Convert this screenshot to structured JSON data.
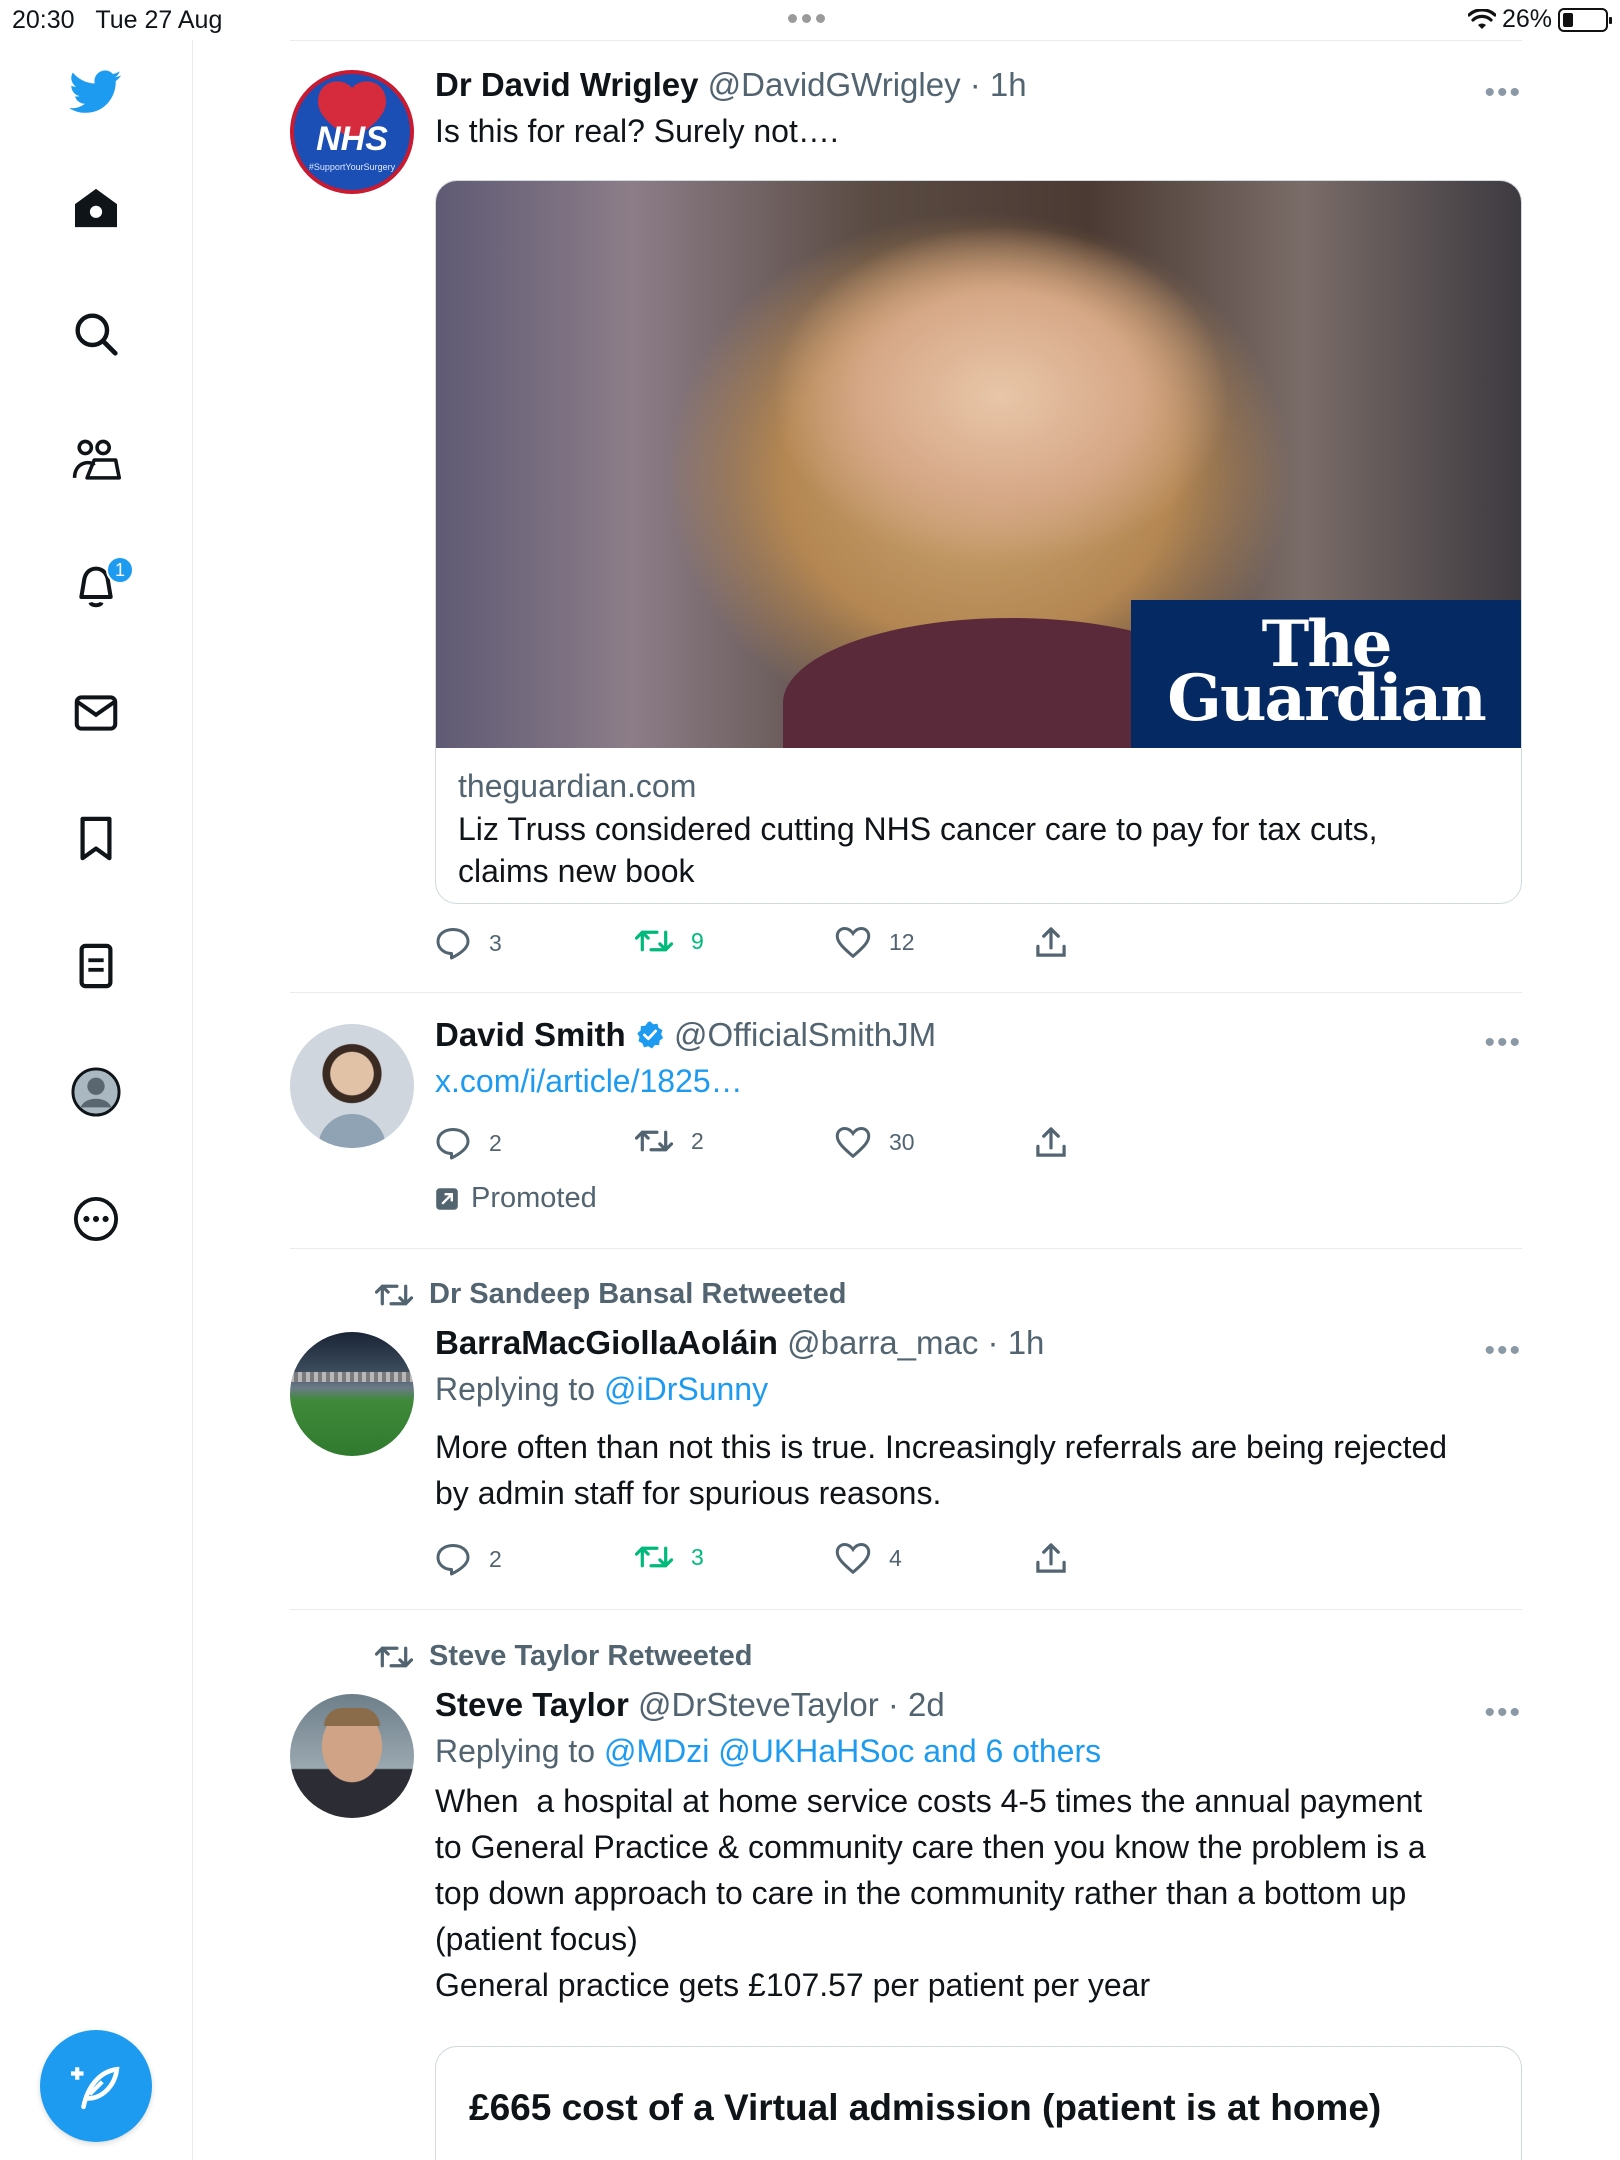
{
  "status_bar": {
    "time": "20:30",
    "date": "Tue 27 Aug",
    "battery": "26%",
    "battery_level": 0.26
  },
  "sidebar": {
    "icons": [
      "twitter-bird-icon",
      "home-icon",
      "search-icon",
      "communities-icon",
      "notifications-icon",
      "messages-icon",
      "bookmarks-icon",
      "lists-icon",
      "profile-icon",
      "more-icon"
    ],
    "notifications_badge": "1"
  },
  "tweets": [
    {
      "name": "Dr David Wrigley",
      "handle": "@DavidGWrigley",
      "time": "· 1h",
      "text": "Is this for real? Surely not….",
      "avatar_label": "NHS",
      "avatar_subtext": "#SupportYourSurgery",
      "card": {
        "brand_line1": "The",
        "brand_line2": "Guardian",
        "domain": "theguardian.com",
        "title_line1": "Liz Truss considered cutting NHS cancer care to pay for tax cuts,",
        "title_line2": "claims new book"
      },
      "replies": "3",
      "retweets": "9",
      "likes": "12"
    },
    {
      "name": "David Smith",
      "handle": "@OfficialSmithJM",
      "verified": true,
      "link": "x.com/i/article/1825…",
      "replies": "2",
      "retweets": "2",
      "likes": "30",
      "promoted_label": "Promoted"
    },
    {
      "context": "Dr Sandeep Bansal Retweeted",
      "name": "BarraMacGiollaAoláin",
      "handle": "@barra_mac",
      "time": "· 1h",
      "reply_prefix": "Replying to",
      "reply_mentions": "@iDrSunny",
      "text_line1": "More often than not this is true. Increasingly referrals are being rejected",
      "text_line2": "by admin staff for spurious reasons.",
      "replies": "2",
      "retweets": "3",
      "likes": "4"
    },
    {
      "context": "Steve Taylor Retweeted",
      "name": "Steve Taylor",
      "handle": "@DrSteveTaylor",
      "time": "· 2d",
      "reply_prefix": "Replying to",
      "reply_mentions": "@MDzi @UKHaHSoc and 6 others",
      "text_lines": [
        "When  a hospital at home service costs 4-5 times the annual payment",
        "to General Practice & community care then you know the problem is a",
        "top down approach to care in the community rather than a bottom up",
        "(patient focus)",
        "General practice gets £107.57 per patient per year"
      ],
      "card_headline": "£665 cost of a Virtual admission (patient is at home)"
    }
  ],
  "colors": {
    "accent": "#1d9bf0",
    "retweet_green": "#00ba7c",
    "muted": "#536471",
    "guardian_blue": "#052962"
  }
}
